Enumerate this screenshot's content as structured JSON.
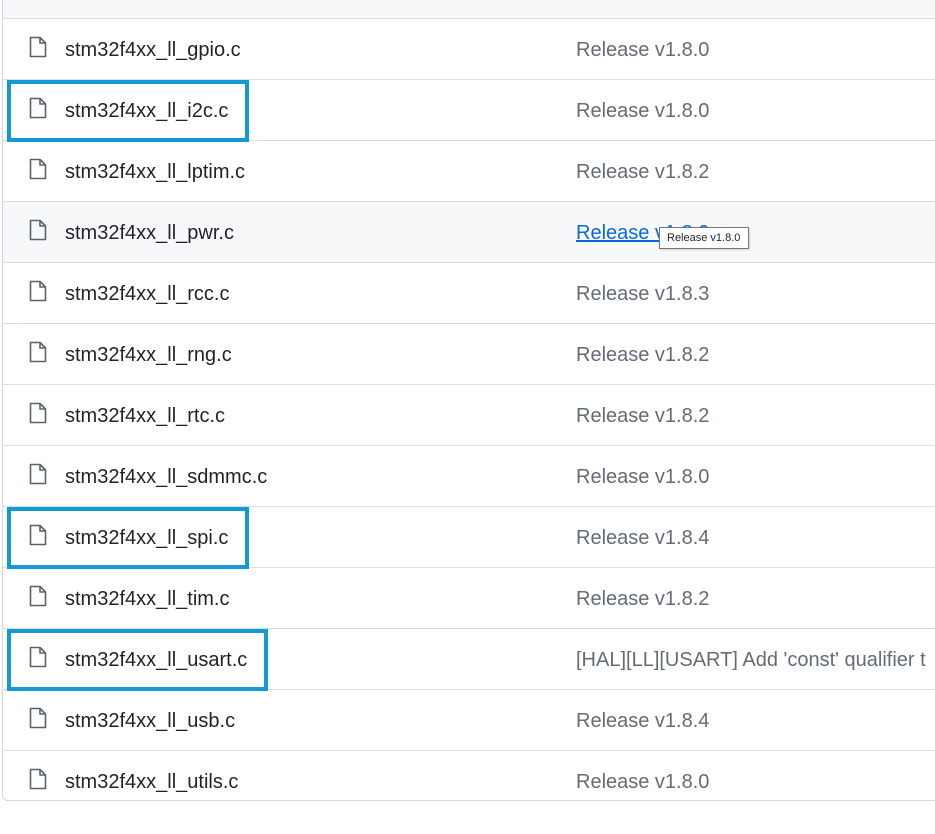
{
  "colors": {
    "highlight": "#139ad6",
    "link": "#0969da",
    "muted_text": "#636c76",
    "file_text": "#1f2328"
  },
  "files": [
    {
      "name": "stm32f4xx_ll_gpio.c",
      "commit": "Release v1.8.0",
      "icon": "file-icon"
    },
    {
      "name": "stm32f4xx_ll_i2c.c",
      "commit": "Release v1.8.0",
      "icon": "file-icon",
      "highlighted": true
    },
    {
      "name": "stm32f4xx_ll_lptim.c",
      "commit": "Release v1.8.2",
      "icon": "file-icon"
    },
    {
      "name": "stm32f4xx_ll_pwr.c",
      "commit": "Release v1.8.0",
      "icon": "file-icon",
      "hovered": true
    },
    {
      "name": "stm32f4xx_ll_rcc.c",
      "commit": "Release v1.8.3",
      "icon": "file-icon"
    },
    {
      "name": "stm32f4xx_ll_rng.c",
      "commit": "Release v1.8.2",
      "icon": "file-icon"
    },
    {
      "name": "stm32f4xx_ll_rtc.c",
      "commit": "Release v1.8.2",
      "icon": "file-icon"
    },
    {
      "name": "stm32f4xx_ll_sdmmc.c",
      "commit": "Release v1.8.0",
      "icon": "file-icon"
    },
    {
      "name": "stm32f4xx_ll_spi.c",
      "commit": "Release v1.8.4",
      "icon": "file-icon",
      "highlighted": true
    },
    {
      "name": "stm32f4xx_ll_tim.c",
      "commit": "Release v1.8.2",
      "icon": "file-icon"
    },
    {
      "name": "stm32f4xx_ll_usart.c",
      "commit": "[HAL][LL][USART] Add 'const' qualifier t",
      "icon": "file-icon",
      "highlighted": true
    },
    {
      "name": "stm32f4xx_ll_usb.c",
      "commit": "Release v1.8.4",
      "icon": "file-icon"
    },
    {
      "name": "stm32f4xx_ll_utils.c",
      "commit": "Release v1.8.0",
      "icon": "file-icon"
    }
  ],
  "tooltip": {
    "text": "Release v1.8.0"
  }
}
